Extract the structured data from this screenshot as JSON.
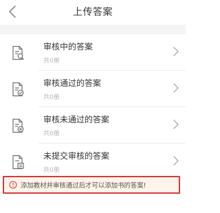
{
  "nav": {
    "title": "上传答案"
  },
  "items": [
    {
      "label": "审核中的答案",
      "count": "共0册"
    },
    {
      "label": "审核通过的答案",
      "count": "共0册"
    },
    {
      "label": "审核未通过的答案",
      "count": "共0册"
    },
    {
      "label": "未提交审核的答案",
      "count": "共0册"
    }
  ],
  "notice": {
    "text": "添加教材并审核通过后才可以添加书的答案!"
  },
  "colors": {
    "notice_border": "#d43a3a",
    "notice_bg": "#fff4ea",
    "notice_icon": "#d43a3a",
    "icon_gray": "#6f6f6f"
  }
}
